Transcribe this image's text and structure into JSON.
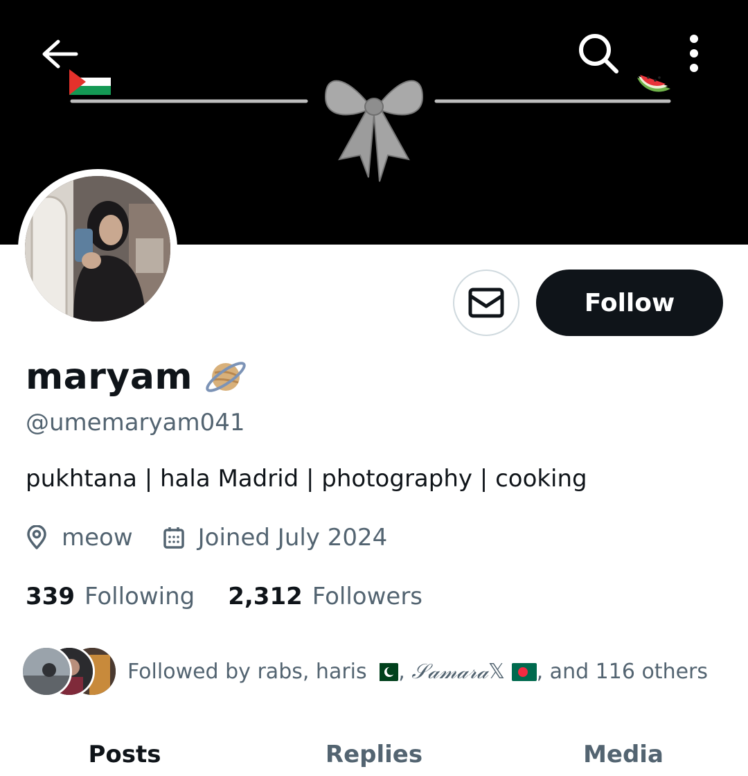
{
  "profile": {
    "display_name": "maryam",
    "handle": "@umemaryam041",
    "bio": "pukhtana | hala Madrid | photography | cooking",
    "location": "meow",
    "joined": "Joined July 2024",
    "following_count": "339",
    "following_label": "Following",
    "followers_count": "2,312",
    "followers_label": "Followers",
    "name_emoji_icon": "ringed-planet-icon"
  },
  "actions": {
    "follow_label": "Follow",
    "message_icon": "envelope-icon"
  },
  "header_icons": {
    "back": "back-arrow-icon",
    "search": "search-icon",
    "more": "more-vertical-icon"
  },
  "banner": {
    "decorations": [
      "palestine-flag-icon",
      "ribbon-bow",
      "watermelon-icon"
    ]
  },
  "followed_by": {
    "text_part1": "Followed by rabs, haris",
    "text_part2": ", ",
    "samara_name": "𝒮𝒶𝓂𝒶𝓇𝒶",
    "x_glyph": "𝕏",
    "text_part3": ", and 116 others",
    "flag_after_haris": "pakistan-flag-icon",
    "flag_after_samara": "bangladesh-flag-icon"
  },
  "tabs": [
    {
      "label": "Posts",
      "active": true
    },
    {
      "label": "Replies",
      "active": false
    },
    {
      "label": "Media",
      "active": false
    }
  ],
  "colors": {
    "primary_text": "#0f1419",
    "secondary_text": "#536471",
    "button_dark": "#0f1419",
    "border": "#cfd9de",
    "banner_bg": "#000000"
  }
}
